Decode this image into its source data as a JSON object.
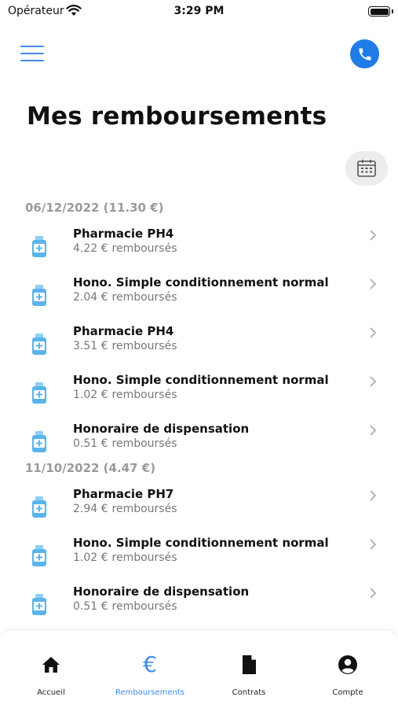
{
  "status_bar": {
    "carrier": "Opérateur",
    "time": "3:29 PM",
    "icons": [
      "wifi-icon",
      "battery-icon"
    ]
  },
  "header": {
    "menu_icon": "hamburger-menu-icon",
    "call_icon": "phone-icon",
    "title": "Mes remboursements",
    "filter_icon": "calendar-icon"
  },
  "colors": {
    "accent": "#3f8cef",
    "call_button": "#1f7be6",
    "group_header": "#9a9a9a",
    "subtitle": "#777777",
    "medicine_icon": "#5ab4ea"
  },
  "groups": [
    {
      "header": "06/12/2022 (11.30 €)",
      "items": [
        {
          "title": "Pharmacie PH4",
          "amount": "4.22 €",
          "status": "remboursés"
        },
        {
          "title": "Hono. Simple conditionnement normal",
          "amount": "2.04 €",
          "status": "remboursés"
        },
        {
          "title": "Pharmacie PH4",
          "amount": "3.51 €",
          "status": "remboursés"
        },
        {
          "title": "Hono. Simple conditionnement normal",
          "amount": "1.02 €",
          "status": "remboursés"
        },
        {
          "title": "Honoraire de dispensation",
          "amount": "0.51 €",
          "status": "remboursés"
        }
      ]
    },
    {
      "header": "11/10/2022 (4.47 €)",
      "items": [
        {
          "title": "Pharmacie PH7",
          "amount": "2.94 €",
          "status": "remboursés"
        },
        {
          "title": "Hono. Simple conditionnement normal",
          "amount": "1.02 €",
          "status": "remboursés"
        },
        {
          "title": "Honoraire de dispensation",
          "amount": "0.51 €",
          "status": "remboursés"
        }
      ]
    }
  ],
  "tab_bar": {
    "active": "Remboursements",
    "tabs": [
      {
        "label": "Accueil",
        "icon": "home-icon"
      },
      {
        "label": "Remboursements",
        "icon": "euro-icon",
        "glyph": "€"
      },
      {
        "label": "Contrats",
        "icon": "document-icon"
      },
      {
        "label": "Compte",
        "icon": "account-icon"
      }
    ]
  }
}
